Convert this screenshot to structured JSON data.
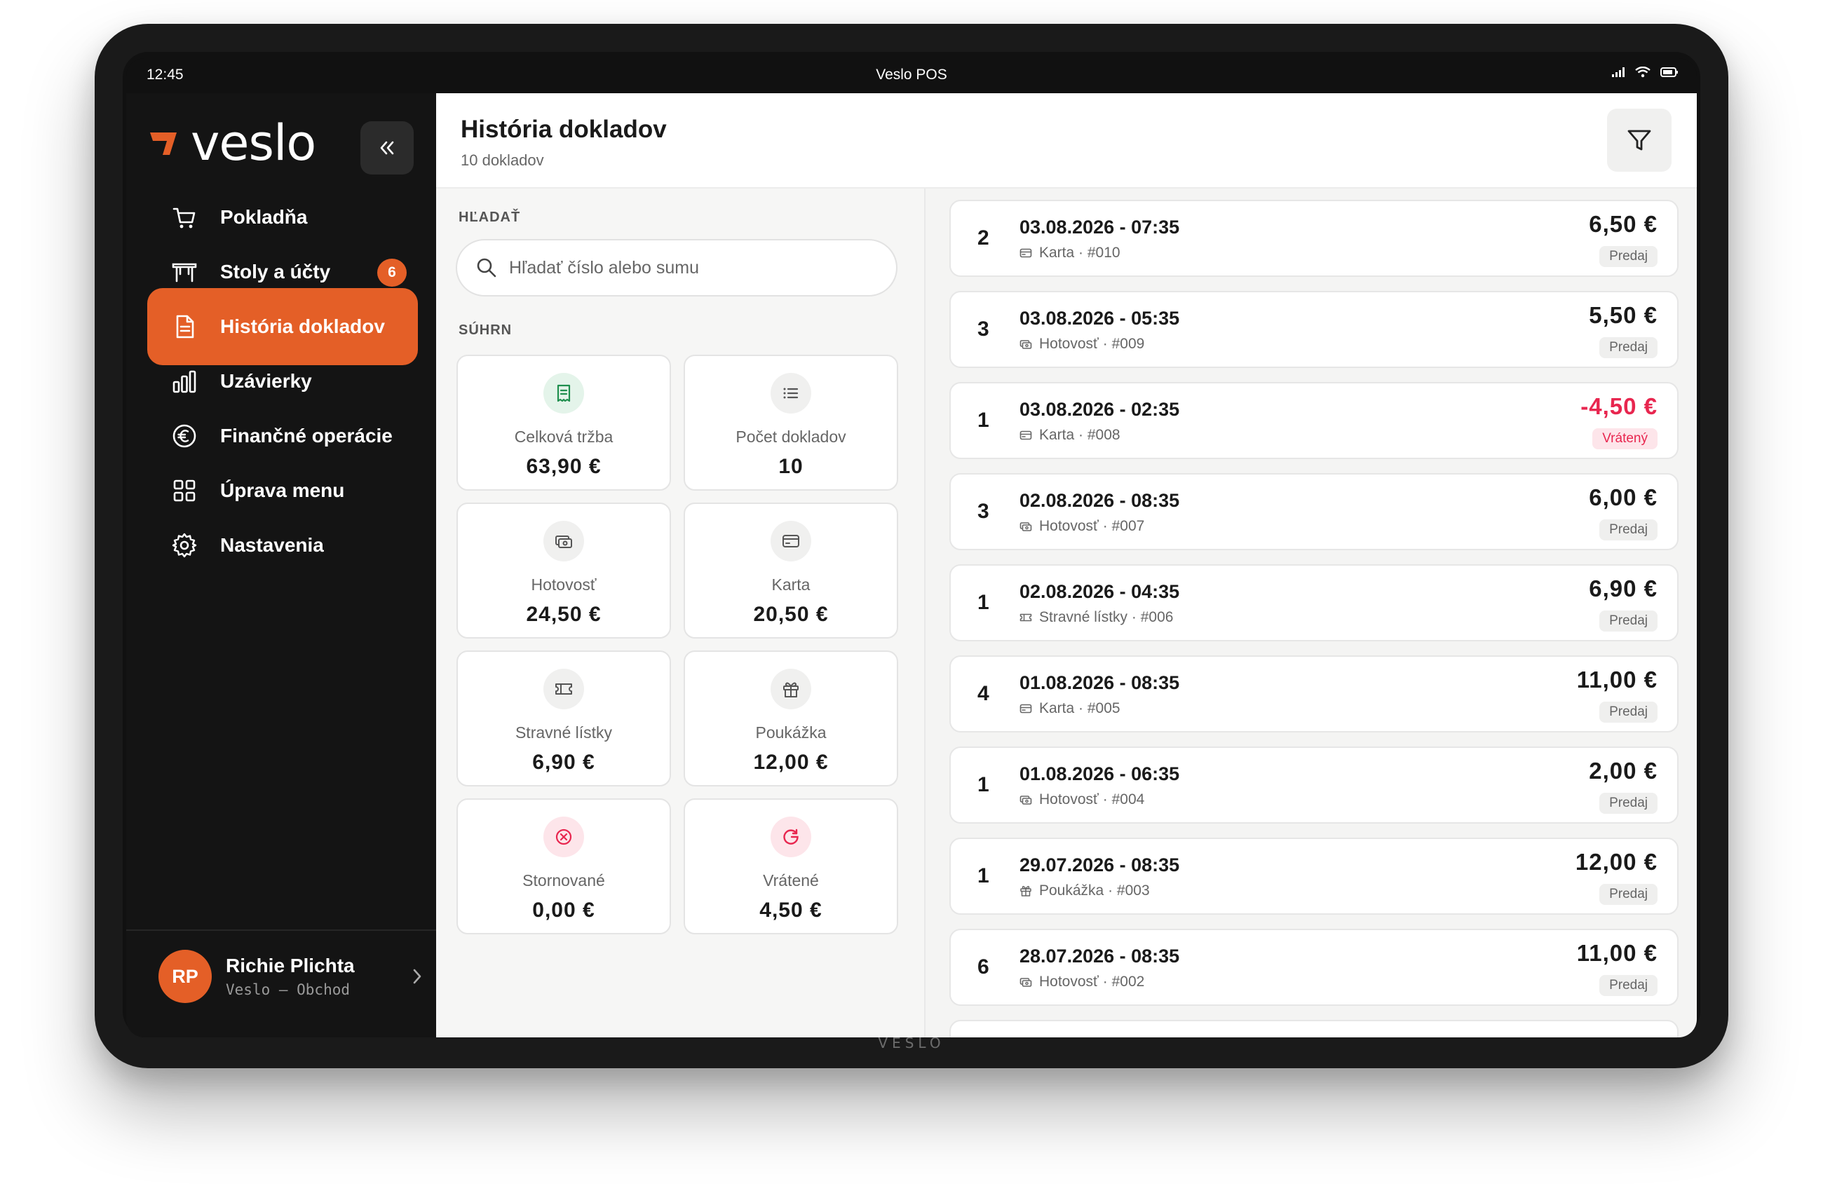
{
  "device": {
    "brand_mark": "VESLO"
  },
  "statusbar": {
    "time": "12:45",
    "app_title": "Veslo POS"
  },
  "sidebar": {
    "logo_text": "veslo",
    "items": [
      {
        "label": "Pokladňa",
        "icon": "cart-icon"
      },
      {
        "label": "Stoly a účty",
        "icon": "table-icon",
        "badge": "6"
      },
      {
        "label": "História dokladov",
        "icon": "document-icon",
        "active": true
      },
      {
        "label": "Uzávierky",
        "icon": "bar-chart-icon"
      },
      {
        "label": "Finančné operácie",
        "icon": "euro-circle-icon"
      },
      {
        "label": "Úprava menu",
        "icon": "grid-icon"
      },
      {
        "label": "Nastavenia",
        "icon": "gear-icon"
      }
    ],
    "user": {
      "initials": "RP",
      "name": "Richie Plichta",
      "shop": "Veslo – Obchod"
    }
  },
  "header": {
    "title": "História dokladov",
    "subtitle": "10 dokladov"
  },
  "search": {
    "label": "HĽADAŤ",
    "placeholder": "Hľadať číslo alebo sumu"
  },
  "summary": {
    "label": "SÚHRN",
    "cards": [
      {
        "label": "Celková tržba",
        "value": "63,90 €",
        "icon": "receipt-icon",
        "color": "#1f8f4e"
      },
      {
        "label": "Počet dokladov",
        "value": "10",
        "icon": "list-icon",
        "color": "#555555"
      },
      {
        "label": "Hotovosť",
        "value": "24,50 €",
        "icon": "cash-icon",
        "color": "#555555"
      },
      {
        "label": "Karta",
        "value": "20,50 €",
        "icon": "card-icon",
        "color": "#555555"
      },
      {
        "label": "Stravné lístky",
        "value": "6,90 €",
        "icon": "ticket-icon",
        "color": "#555555"
      },
      {
        "label": "Poukážka",
        "value": "12,00 €",
        "icon": "gift-icon",
        "color": "#555555"
      },
      {
        "label": "Stornované",
        "value": "0,00 €",
        "icon": "cancel-icon",
        "color": "#e8264f"
      },
      {
        "label": "Vrátené",
        "value": "4,50 €",
        "icon": "refund-icon",
        "color": "#e8264f"
      }
    ]
  },
  "receipts": [
    {
      "qty": "2",
      "datetime": "03.08.2026 - 07:35",
      "method": "Karta",
      "number": "#010",
      "amount": "6,50 €",
      "type": "Predaj",
      "icon": "card-icon"
    },
    {
      "qty": "3",
      "datetime": "03.08.2026 - 05:35",
      "method": "Hotovosť",
      "number": "#009",
      "amount": "5,50 €",
      "type": "Predaj",
      "icon": "cash-icon"
    },
    {
      "qty": "1",
      "datetime": "03.08.2026 - 02:35",
      "method": "Karta",
      "number": "#008",
      "amount": "-4,50 €",
      "type": "Vrátený",
      "icon": "card-icon",
      "refund": true
    },
    {
      "qty": "3",
      "datetime": "02.08.2026 - 08:35",
      "method": "Hotovosť",
      "number": "#007",
      "amount": "6,00 €",
      "type": "Predaj",
      "icon": "cash-icon"
    },
    {
      "qty": "1",
      "datetime": "02.08.2026 - 04:35",
      "method": "Stravné lístky",
      "number": "#006",
      "amount": "6,90 €",
      "type": "Predaj",
      "icon": "ticket-icon"
    },
    {
      "qty": "4",
      "datetime": "01.08.2026 - 08:35",
      "method": "Karta",
      "number": "#005",
      "amount": "11,00 €",
      "type": "Predaj",
      "icon": "card-icon"
    },
    {
      "qty": "1",
      "datetime": "01.08.2026 - 06:35",
      "method": "Hotovosť",
      "number": "#004",
      "amount": "2,00 €",
      "type": "Predaj",
      "icon": "cash-icon"
    },
    {
      "qty": "1",
      "datetime": "29.07.2026 - 08:35",
      "method": "Poukážka",
      "number": "#003",
      "amount": "12,00 €",
      "type": "Predaj",
      "icon": "gift-icon"
    },
    {
      "qty": "6",
      "datetime": "28.07.2026 - 08:35",
      "method": "Hotovosť",
      "number": "#002",
      "amount": "11,00 €",
      "type": "Predaj",
      "icon": "cash-icon"
    }
  ],
  "colors": {
    "accent": "#e45f27",
    "negative": "#e8264f",
    "positive": "#1f8f4e"
  }
}
